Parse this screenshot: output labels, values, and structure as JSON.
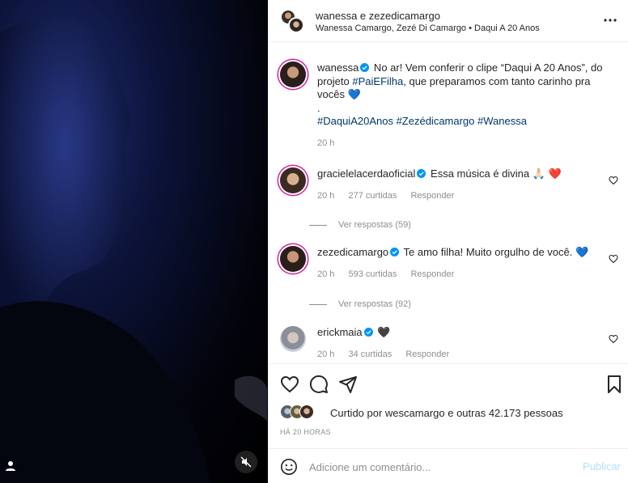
{
  "header": {
    "title": "wanessa e zezedicamargo",
    "subtitle": "Wanessa Camargo, Zezé Di Camargo • Daqui A 20 Anos"
  },
  "caption": {
    "username": "wanessa",
    "text_1": " No ar! Vem conferir o clipe “Daqui A 20 Anos”, do projeto ",
    "hashtag_1": "#PaiEFilha",
    "text_2": ", que preparamos com tanto carinho pra vocês ",
    "emoji": "💙",
    "dot": ".",
    "hashtags": "#DaquiA20Anos #Zezédicamargo #Wanessa",
    "time": "20 h"
  },
  "comments": [
    {
      "username": "gracielelacerdaoficial",
      "text": " Essa música é divina ",
      "emoji": "🙏🏻 ❤️",
      "time": "20 h",
      "likes": "277 curtidas",
      "reply": "Responder",
      "view_replies": "Ver respostas (59)"
    },
    {
      "username": "zezedicamargo",
      "text": " Te amo filha! Muito orgulho de você. ",
      "emoji": "💙",
      "time": "20 h",
      "likes": "593 curtidas",
      "reply": "Responder",
      "view_replies": "Ver respostas (92)"
    },
    {
      "username": "erickmaia",
      "text": " ",
      "emoji": "🖤",
      "time": "20 h",
      "likes": "34 curtidas",
      "reply": "Responder"
    }
  ],
  "likes_summary": {
    "prefix": "Curtido por ",
    "user": "wescamargo",
    "suffix": " e outras 42.173 pessoas"
  },
  "timestamp": "HÁ 20 HORAS",
  "add_comment": {
    "placeholder": "Adicione um comentário...",
    "publish": "Publicar"
  },
  "colors": {
    "link": "#00376b",
    "verified": "#0095f6",
    "publish_disabled": "#b2dffc",
    "muted_text": "#8e8e8e"
  },
  "icons": [
    "more-icon",
    "verified-icon",
    "heart-icon",
    "comment-icon",
    "share-icon",
    "save-icon",
    "emoji-icon",
    "mute-icon",
    "user-tag-icon"
  ]
}
